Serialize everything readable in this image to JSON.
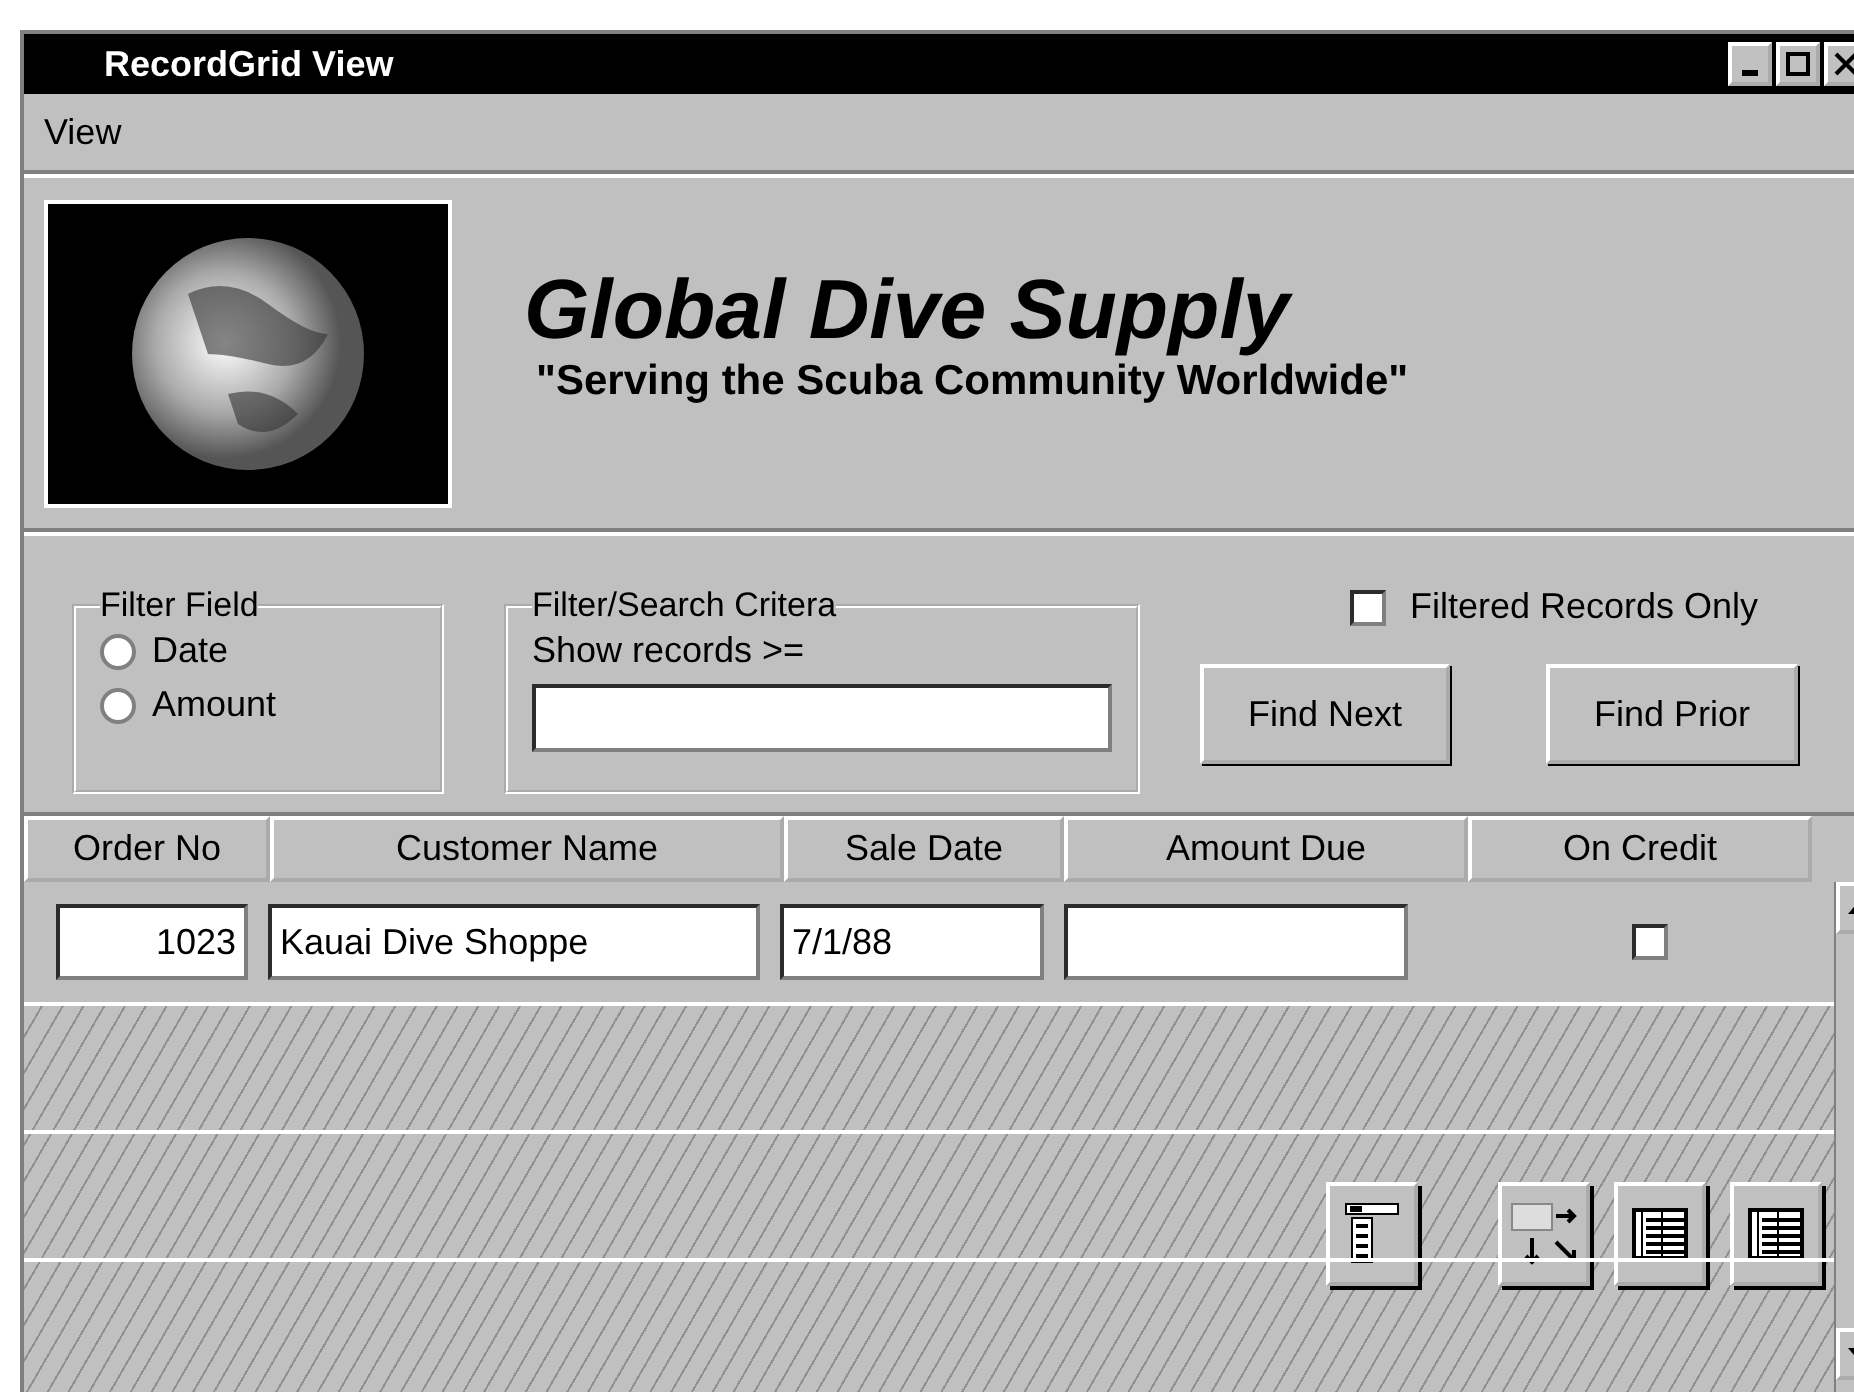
{
  "window": {
    "title": "RecordGrid View"
  },
  "menu": [
    {
      "label": "View"
    }
  ],
  "header": {
    "title": "Global Dive Supply",
    "tagline": "\"Serving the Scuba Community Worldwide\""
  },
  "filter_field": {
    "legend": "Filter Field",
    "options": [
      {
        "label": "Date",
        "selected": false
      },
      {
        "label": "Amount",
        "selected": false
      }
    ]
  },
  "search_criteria": {
    "legend": "Filter/Search Critera",
    "label": "Show records >="
  },
  "filtered_only": {
    "label": "Filtered Records Only",
    "checked": false
  },
  "buttons": [
    {
      "label": "Find Next"
    },
    {
      "label": "Find Prior"
    }
  ],
  "grid": {
    "columns": [
      "Order No",
      "Customer Name",
      "Sale Date",
      "Amount Due",
      "On Credit"
    ],
    "rows": [
      {
        "order_no": "1023",
        "customer_name": "Kauai Dive Shoppe",
        "sale_date": "7/1/88",
        "on_credit": false
      }
    ]
  }
}
